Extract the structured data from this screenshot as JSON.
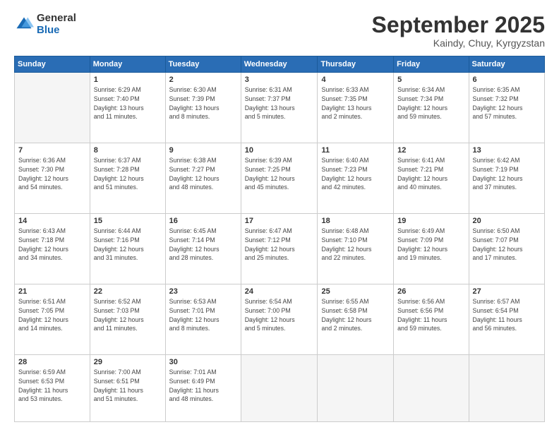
{
  "logo": {
    "general": "General",
    "blue": "Blue"
  },
  "title": "September 2025",
  "location": "Kaindy, Chuy, Kyrgyzstan",
  "headers": [
    "Sunday",
    "Monday",
    "Tuesday",
    "Wednesday",
    "Thursday",
    "Friday",
    "Saturday"
  ],
  "weeks": [
    [
      {
        "day": "",
        "info": ""
      },
      {
        "day": "1",
        "info": "Sunrise: 6:29 AM\nSunset: 7:40 PM\nDaylight: 13 hours\nand 11 minutes."
      },
      {
        "day": "2",
        "info": "Sunrise: 6:30 AM\nSunset: 7:39 PM\nDaylight: 13 hours\nand 8 minutes."
      },
      {
        "day": "3",
        "info": "Sunrise: 6:31 AM\nSunset: 7:37 PM\nDaylight: 13 hours\nand 5 minutes."
      },
      {
        "day": "4",
        "info": "Sunrise: 6:33 AM\nSunset: 7:35 PM\nDaylight: 13 hours\nand 2 minutes."
      },
      {
        "day": "5",
        "info": "Sunrise: 6:34 AM\nSunset: 7:34 PM\nDaylight: 12 hours\nand 59 minutes."
      },
      {
        "day": "6",
        "info": "Sunrise: 6:35 AM\nSunset: 7:32 PM\nDaylight: 12 hours\nand 57 minutes."
      }
    ],
    [
      {
        "day": "7",
        "info": "Sunrise: 6:36 AM\nSunset: 7:30 PM\nDaylight: 12 hours\nand 54 minutes."
      },
      {
        "day": "8",
        "info": "Sunrise: 6:37 AM\nSunset: 7:28 PM\nDaylight: 12 hours\nand 51 minutes."
      },
      {
        "day": "9",
        "info": "Sunrise: 6:38 AM\nSunset: 7:27 PM\nDaylight: 12 hours\nand 48 minutes."
      },
      {
        "day": "10",
        "info": "Sunrise: 6:39 AM\nSunset: 7:25 PM\nDaylight: 12 hours\nand 45 minutes."
      },
      {
        "day": "11",
        "info": "Sunrise: 6:40 AM\nSunset: 7:23 PM\nDaylight: 12 hours\nand 42 minutes."
      },
      {
        "day": "12",
        "info": "Sunrise: 6:41 AM\nSunset: 7:21 PM\nDaylight: 12 hours\nand 40 minutes."
      },
      {
        "day": "13",
        "info": "Sunrise: 6:42 AM\nSunset: 7:19 PM\nDaylight: 12 hours\nand 37 minutes."
      }
    ],
    [
      {
        "day": "14",
        "info": "Sunrise: 6:43 AM\nSunset: 7:18 PM\nDaylight: 12 hours\nand 34 minutes."
      },
      {
        "day": "15",
        "info": "Sunrise: 6:44 AM\nSunset: 7:16 PM\nDaylight: 12 hours\nand 31 minutes."
      },
      {
        "day": "16",
        "info": "Sunrise: 6:45 AM\nSunset: 7:14 PM\nDaylight: 12 hours\nand 28 minutes."
      },
      {
        "day": "17",
        "info": "Sunrise: 6:47 AM\nSunset: 7:12 PM\nDaylight: 12 hours\nand 25 minutes."
      },
      {
        "day": "18",
        "info": "Sunrise: 6:48 AM\nSunset: 7:10 PM\nDaylight: 12 hours\nand 22 minutes."
      },
      {
        "day": "19",
        "info": "Sunrise: 6:49 AM\nSunset: 7:09 PM\nDaylight: 12 hours\nand 19 minutes."
      },
      {
        "day": "20",
        "info": "Sunrise: 6:50 AM\nSunset: 7:07 PM\nDaylight: 12 hours\nand 17 minutes."
      }
    ],
    [
      {
        "day": "21",
        "info": "Sunrise: 6:51 AM\nSunset: 7:05 PM\nDaylight: 12 hours\nand 14 minutes."
      },
      {
        "day": "22",
        "info": "Sunrise: 6:52 AM\nSunset: 7:03 PM\nDaylight: 12 hours\nand 11 minutes."
      },
      {
        "day": "23",
        "info": "Sunrise: 6:53 AM\nSunset: 7:01 PM\nDaylight: 12 hours\nand 8 minutes."
      },
      {
        "day": "24",
        "info": "Sunrise: 6:54 AM\nSunset: 7:00 PM\nDaylight: 12 hours\nand 5 minutes."
      },
      {
        "day": "25",
        "info": "Sunrise: 6:55 AM\nSunset: 6:58 PM\nDaylight: 12 hours\nand 2 minutes."
      },
      {
        "day": "26",
        "info": "Sunrise: 6:56 AM\nSunset: 6:56 PM\nDaylight: 11 hours\nand 59 minutes."
      },
      {
        "day": "27",
        "info": "Sunrise: 6:57 AM\nSunset: 6:54 PM\nDaylight: 11 hours\nand 56 minutes."
      }
    ],
    [
      {
        "day": "28",
        "info": "Sunrise: 6:59 AM\nSunset: 6:53 PM\nDaylight: 11 hours\nand 53 minutes."
      },
      {
        "day": "29",
        "info": "Sunrise: 7:00 AM\nSunset: 6:51 PM\nDaylight: 11 hours\nand 51 minutes."
      },
      {
        "day": "30",
        "info": "Sunrise: 7:01 AM\nSunset: 6:49 PM\nDaylight: 11 hours\nand 48 minutes."
      },
      {
        "day": "",
        "info": ""
      },
      {
        "day": "",
        "info": ""
      },
      {
        "day": "",
        "info": ""
      },
      {
        "day": "",
        "info": ""
      }
    ]
  ]
}
